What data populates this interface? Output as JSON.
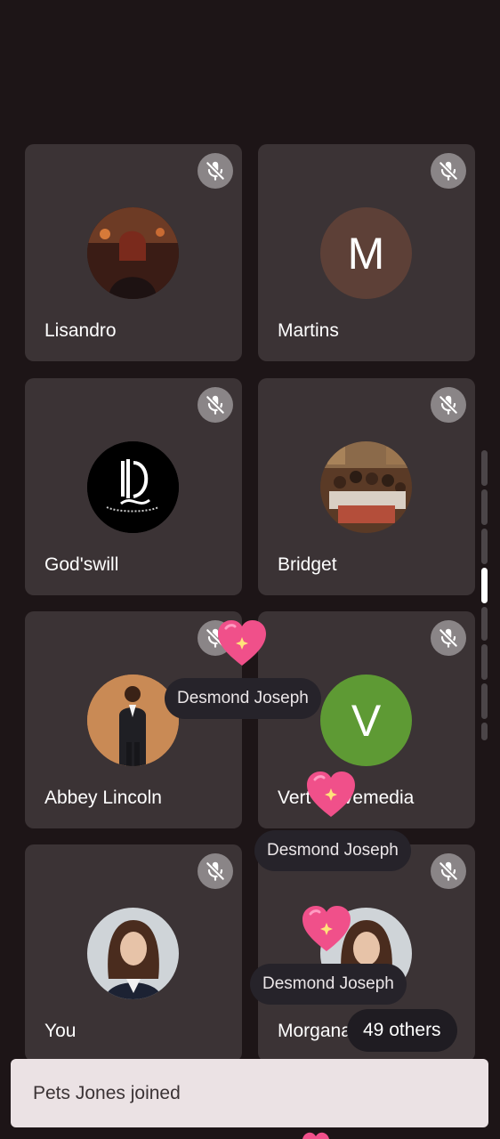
{
  "participants": [
    {
      "name": "Lisandro",
      "avatar_type": "photo"
    },
    {
      "name": "Martins",
      "avatar_type": "letter",
      "letter": "M",
      "color": "#5d4037"
    },
    {
      "name": "God'swill",
      "avatar_type": "logo"
    },
    {
      "name": "Bridget",
      "avatar_type": "photo"
    },
    {
      "name": "Abbey Lincoln",
      "avatar_type": "photo"
    },
    {
      "name": "Vert Wavemedia",
      "avatar_type": "letter",
      "letter": "V",
      "color": "#5e9a34"
    },
    {
      "name": "You",
      "avatar_type": "photo"
    },
    {
      "name": "Morgana",
      "avatar_type": "photo"
    }
  ],
  "reactions": [
    {
      "sender": "Desmond Joseph",
      "icon": "heart-icon"
    },
    {
      "sender": "Desmond Joseph",
      "icon": "heart-icon"
    },
    {
      "sender": "Desmond Joseph",
      "icon": "heart-icon"
    }
  ],
  "others_label": "49 others",
  "toast": {
    "text": "Pets Jones joined"
  },
  "colors": {
    "background": "#1d1517",
    "tile": "#3b3335",
    "mic_badge": "#8a8587",
    "heart": "#f0508a"
  }
}
